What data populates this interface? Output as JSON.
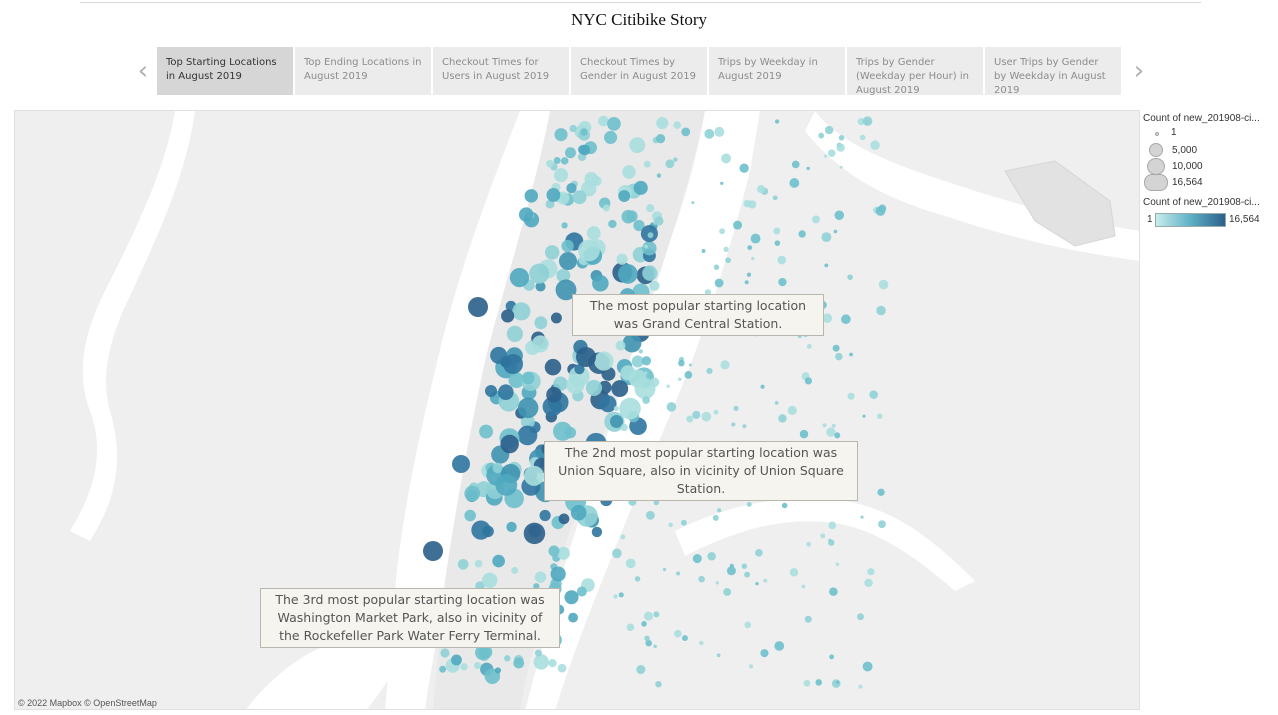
{
  "title": "NYC Citibike Story",
  "nav": {
    "tabs": [
      {
        "label": "Top Starting Locations in August 2019",
        "active": true
      },
      {
        "label": "Top Ending Locations in August 2019",
        "active": false
      },
      {
        "label": "Checkout Times for Users in August 2019",
        "active": false
      },
      {
        "label": "Checkout Times by Gender in August 2019",
        "active": false
      },
      {
        "label": "Trips by Weekday in August 2019",
        "active": false
      },
      {
        "label": "Trips by Gender (Weekday per Hour) in August 2019",
        "active": false
      },
      {
        "label": "User Trips by Gender by Weekday in August 2019",
        "active": false
      }
    ],
    "prev_icon": "chevron-left-icon",
    "next_icon": "chevron-right-icon"
  },
  "callouts": {
    "first": "The most popular starting location was Grand Central Station.",
    "second": "The 2nd most popular starting location was Union Square, also in vicinity of Union Square Station.",
    "third": "The 3rd most popular starting location was Washington Market Park, also in vicinity of the Rockefeller Park Water Ferry Terminal."
  },
  "attribution": "© 2022 Mapbox  © OpenStreetMap",
  "legend": {
    "size_title": "Count of new_201908-ci...",
    "size_items": [
      "1",
      "5,000",
      "10,000",
      "16,564"
    ],
    "color_title": "Count of new_201908-ci...",
    "color_min": "1",
    "color_max": "16,564",
    "colors": {
      "low": "#c7ecec",
      "mid": "#5fb0c6",
      "high": "#2b5f8b"
    }
  }
}
